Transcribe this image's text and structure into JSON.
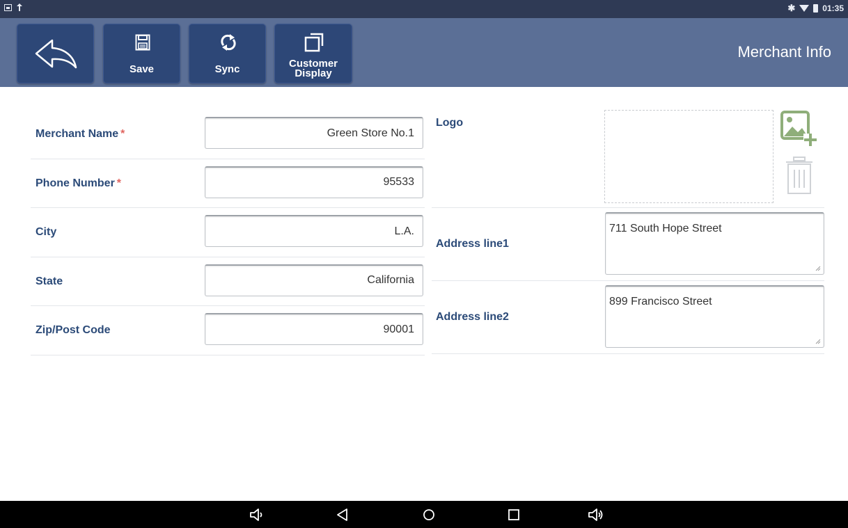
{
  "status_bar": {
    "time": "01:35",
    "left_icons": [
      "image-icon",
      "upload-icon"
    ],
    "right_icons": [
      "bluetooth-icon",
      "wifi-icon",
      "battery-icon"
    ]
  },
  "toolbar": {
    "back_icon": "back-arrow-icon",
    "save_label": "Save",
    "save_icon": "floppy-disk-icon",
    "sync_label": "Sync",
    "sync_icon": "sync-icon",
    "customer_display_label_line1": "Customer",
    "customer_display_label_line2": "Display",
    "customer_display_icon": "external-display-icon",
    "title": "Merchant Info"
  },
  "form": {
    "merchant_name": {
      "label": "Merchant Name",
      "required_mark": "*",
      "value": "Green Store No.1"
    },
    "phone_number": {
      "label": "Phone Number",
      "required_mark": "*",
      "value": "95533"
    },
    "city": {
      "label": "City",
      "value": "L.A."
    },
    "state": {
      "label": "State",
      "value": "California"
    },
    "zip": {
      "label": "Zip/Post Code",
      "value": "90001"
    },
    "logo": {
      "label": "Logo",
      "add_icon": "add-image-icon",
      "delete_icon": "trash-icon"
    },
    "address_line1": {
      "label": "Address line1",
      "value": "711 South Hope Street"
    },
    "address_line2": {
      "label": "Address line2",
      "value": "899 Francisco Street"
    }
  },
  "nav_bar": {
    "buttons": [
      "volume-down-icon",
      "back-icon",
      "home-icon",
      "recents-icon",
      "volume-up-icon"
    ]
  },
  "colors": {
    "status_bar_bg": "#2f3a55",
    "app_bar_bg": "#5b6f96",
    "toolbar_button_bg": "#2d4777",
    "label_text": "#2b4a78",
    "required_mark": "#e06560",
    "add_image_icon": "#8fae7a",
    "nav_bar_bg": "#000000"
  }
}
